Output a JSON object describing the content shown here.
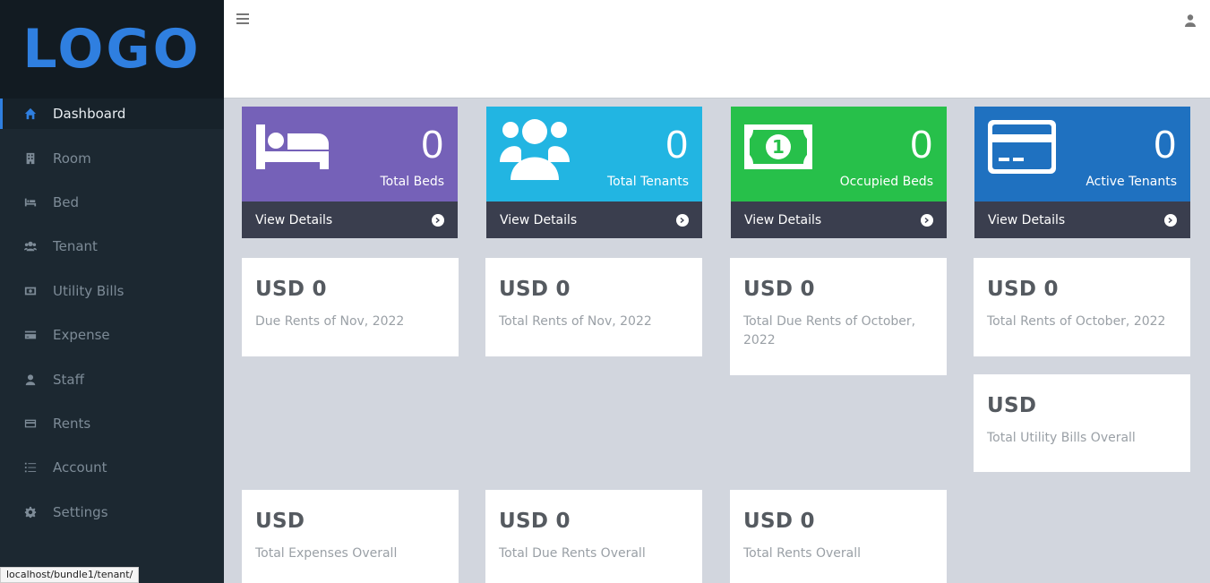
{
  "brand": {
    "logo": "LOGO"
  },
  "sidebar": {
    "items": [
      {
        "label": "Dashboard",
        "icon": "home-icon",
        "active": true
      },
      {
        "label": "Room",
        "icon": "building-icon"
      },
      {
        "label": "Bed",
        "icon": "bed-icon"
      },
      {
        "label": "Tenant",
        "icon": "users-icon"
      },
      {
        "label": "Utility Bills",
        "icon": "money-bill-icon"
      },
      {
        "label": "Expense",
        "icon": "credit-card-icon"
      },
      {
        "label": "Staff",
        "icon": "user-icon"
      },
      {
        "label": "Rents",
        "icon": "card-icon"
      },
      {
        "label": "Account",
        "icon": "list-icon"
      },
      {
        "label": "Settings",
        "icon": "gear-icon"
      }
    ]
  },
  "header": {
    "menu_icon": "hamburger-icon",
    "user_icon": "user-icon"
  },
  "stats": [
    {
      "value": "0",
      "label": "Total Beds",
      "link": "View Details",
      "color": "#7561b8",
      "icon": "bed-icon"
    },
    {
      "value": "0",
      "label": "Total Tenants",
      "link": "View Details",
      "color": "#22b5e2",
      "icon": "users-icon"
    },
    {
      "value": "0",
      "label": "Occupied Beds",
      "link": "View Details",
      "color": "#27c04a",
      "icon": "money-bill-icon"
    },
    {
      "value": "0",
      "label": "Active Tenants",
      "link": "View Details",
      "color": "#1f71c0",
      "icon": "credit-card-icon"
    }
  ],
  "info": [
    {
      "amount": "USD 0",
      "desc": "Due Rents of Nov, 2022"
    },
    {
      "amount": "USD 0",
      "desc": "Total Rents of Nov, 2022"
    },
    {
      "amount": "USD 0",
      "desc": "Total Due Rents of October, 2022"
    },
    {
      "amount": "USD 0",
      "desc": "Total Rents of October, 2022"
    },
    {
      "amount": "USD",
      "desc": "Total Utility Bills Overall"
    },
    {
      "amount": "USD",
      "desc": "Total Expenses Overall"
    },
    {
      "amount": "USD 0",
      "desc": "Total Due Rents Overall"
    },
    {
      "amount": "USD 0",
      "desc": "Total Rents Overall"
    }
  ],
  "status_bar": {
    "url": "localhost/bundle1/tenant/"
  },
  "colors": {
    "accent": "#2f7fe0",
    "sidebar": "#1c2831",
    "footer": "#3a3e4e",
    "background": "#d2d6de"
  }
}
